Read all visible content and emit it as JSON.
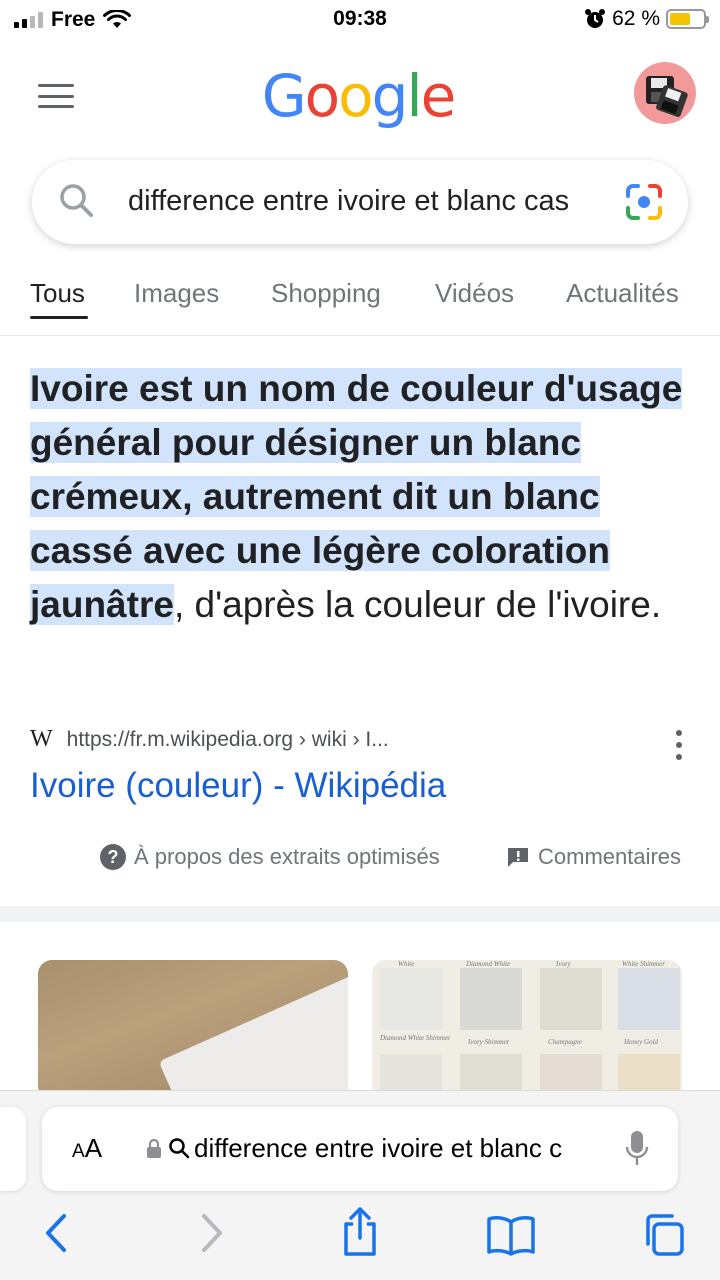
{
  "status_bar": {
    "carrier": "Free",
    "time": "09:38",
    "battery_percent": "62 %",
    "battery_level": 0.62
  },
  "header": {
    "logo_text": "Google",
    "logo_colors": [
      "#4285F4",
      "#EA4335",
      "#FBBC05",
      "#4285F4",
      "#34A853",
      "#EA4335"
    ]
  },
  "search": {
    "query": "difference entre ivoire et blanc cas"
  },
  "tabs": [
    {
      "label": "Tous",
      "active": true
    },
    {
      "label": "Images",
      "active": false
    },
    {
      "label": "Shopping",
      "active": false
    },
    {
      "label": "Vidéos",
      "active": false
    },
    {
      "label": "Actualités",
      "active": false
    }
  ],
  "snippet": {
    "highlighted": "Ivoire est un nom de couleur d'usage général pour désigner un blanc crémeux, autrement dit un blanc cassé avec une légère coloration jaunâtre",
    "rest": ", d'après la couleur de l'ivoire."
  },
  "result": {
    "source_icon": "W",
    "url": "https://fr.m.wikipedia.org › wiki › I...",
    "title": "Ivoire (couleur) - Wikipédia"
  },
  "feedback": {
    "about_label": "À propos des extraits optimisés",
    "comments_label": "Commentaires"
  },
  "swatches": {
    "labels": [
      "White",
      "Diamond White",
      "Ivory",
      "White Shimmer",
      "Diamond White Shimmer",
      "Ivory Shimmer",
      "Champagne",
      "Honey Gold"
    ]
  },
  "safari": {
    "aa_label": "AA",
    "address_text": "difference entre ivoire et blanc c"
  },
  "colors": {
    "link": "#1a5fd0",
    "highlight": "#d2e3fc",
    "ios_blue": "#1a73e8"
  }
}
